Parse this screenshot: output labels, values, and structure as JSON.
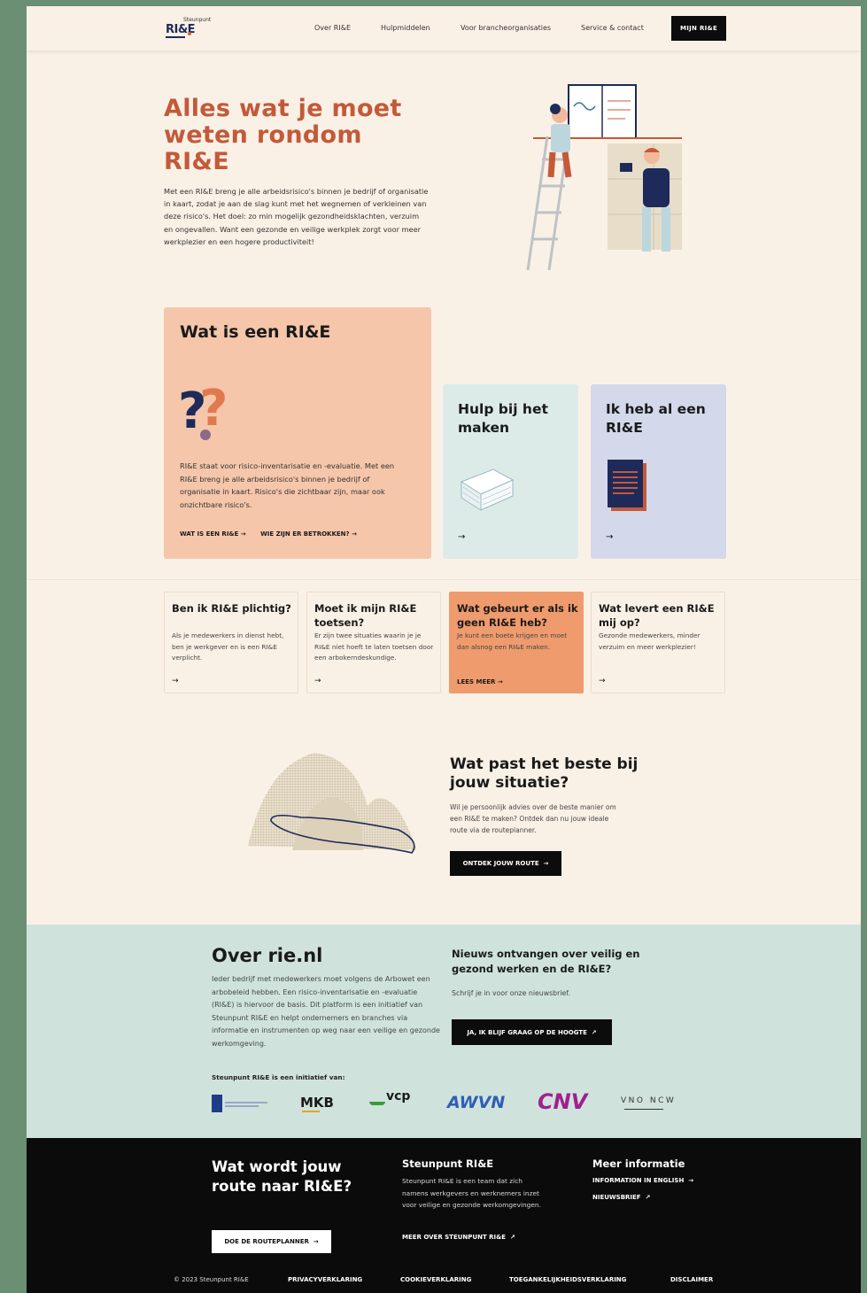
{
  "header": {
    "logo_small": "Steunpunt",
    "logo_big": "RI&E",
    "nav": [
      "Over RI&E",
      "Hulpmiddelen",
      "Voor brancheorganisaties",
      "Service & contact"
    ],
    "cta": "MIJN RI&E"
  },
  "hero": {
    "title": "Alles wat je moet weten rondom RI&E",
    "text": "Met een RI&E breng je alle arbeidsrisico's binnen je bedrijf of organisatie in kaart, zodat je aan de slag kunt met het wegnemen of verkleinen van deze risico's. Het doel: zo min mogelijk gezondheidsklachten, verzuim en ongevallen. Want een gezonde en veilige werkplek zorgt voor meer werkplezier en een hogere productiviteit!"
  },
  "card_big": {
    "title": "Wat is een RI&E",
    "text": "RI&E staat voor risico-inventarisatie en -evaluatie. Met een RI&E breng je alle arbeidsrisico's binnen je bedrijf of organisatie in kaart. Risico's die zichtbaar zijn, maar ook onzichtbare risico's.",
    "link1": "WAT IS EEN RI&E",
    "link2": "WIE ZIJN ER BETROKKEN?"
  },
  "card_help": {
    "title": "Hulp bij het maken"
  },
  "card_have": {
    "title": "Ik heb al een RI&E"
  },
  "small_cards": [
    {
      "title": "Ben ik RI&E plichtig?",
      "text": "Als je medewerkers in dienst hebt, ben je werkgever en is een RI&E verplicht."
    },
    {
      "title": "Moet ik mijn RI&E toetsen?",
      "text": "Er zijn twee situaties waarin je je RI&E niet hoeft te laten toetsen door een arbokerndeskundige."
    },
    {
      "title": "Wat gebeurt er als ik geen RI&E heb?",
      "text": "Je kunt een boete krijgen en moet dan alsnog een RI&E maken.",
      "more": "LEES MEER"
    },
    {
      "title": "Wat levert een RI&E mij op?",
      "text": "Gezonde medewerkers, minder verzuim en meer werkplezier!"
    }
  ],
  "route": {
    "title": "Wat past het beste bij jouw situatie?",
    "text": "Wil je persoonlijk advies over de beste manier om een RI&E te maken? Ontdek dan nu jouw ideale route via de routeplanner.",
    "button": "ONTDEK JOUW ROUTE"
  },
  "over": {
    "title": "Over rie.nl",
    "text": "Ieder bedrijf met medewerkers moet volgens de Arbowet een arbobeleid hebben. Een risico-inventarisatie en -evaluatie (RI&E) is hiervoor de basis. Dit platform is een initiatief van Steunpunt RI&E en helpt ondernemers en branches via informatie en instrumenten op weg naar een veilige en gezonde werkomgeving.",
    "news_title": "Nieuws ontvangen over veilig en gezond werken en de RI&E?",
    "news_text": "Schrijf je in voor onze nieuwsbrief.",
    "news_button": "JA, IK BLIJF GRAAG OP DE HOOGTE",
    "initiatief": "Steunpunt RI&E is een initiatief van:",
    "partners": [
      "MKB",
      "vcp",
      "AWVN",
      "CNV",
      "VNO NCW"
    ]
  },
  "footer": {
    "title": "Wat wordt jouw route naar RI&E?",
    "button": "DOE DE ROUTEPLANNER",
    "col2_title": "Steunpunt RI&E",
    "col2_text": "Steunpunt RI&E is een team dat zich namens werkgevers en werknemers inzet voor veilige en gezonde werkomgevingen.",
    "col2_link": "MEER OVER STEUNPUNT RI&E",
    "col3_title": "Meer informatie",
    "col3_link1": "INFORMATION IN ENGLISH",
    "col3_link2": "NIEUWSBRIEF",
    "copyright": "© 2023 Steunpunt RI&E",
    "legal": [
      "PRIVACYVERKLARING",
      "COOKIEVERKLARING",
      "TOEGANKELIJKHEIDSVERKLARING",
      "DISCLAIMER"
    ]
  },
  "colors": {
    "accent": "#c4593a",
    "card_peach": "#f5c6aa",
    "card_mint": "#dcebe8",
    "card_lavender": "#d3d8ea",
    "highlight": "#ef9b6d",
    "band": "#cfe3dc"
  }
}
